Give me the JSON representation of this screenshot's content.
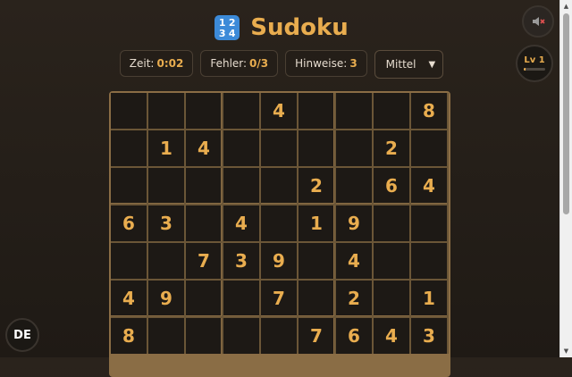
{
  "header": {
    "icon_digits": [
      "1",
      "2",
      "3",
      "4"
    ],
    "title": "Sudoku"
  },
  "stats": {
    "time_label": "Zeit:",
    "time_value": "0:02",
    "errors_label": "Fehler:",
    "errors_value": "0/3",
    "hints_label": "Hinweise:",
    "hints_value": "3"
  },
  "difficulty": {
    "selected": "Mittel"
  },
  "controls": {
    "mute_icon": "speaker-muted-icon",
    "level_label": "Lv 1",
    "level_progress": 0.1,
    "language": "DE"
  },
  "board": {
    "rows": [
      [
        "",
        "",
        "",
        "",
        "4",
        "",
        "",
        "",
        "8"
      ],
      [
        "",
        "1",
        "4",
        "",
        "",
        "",
        "",
        "2",
        ""
      ],
      [
        "",
        "",
        "",
        "",
        "",
        "2",
        "",
        "6",
        "4"
      ],
      [
        "6",
        "3",
        "",
        "4",
        "",
        "1",
        "9",
        "",
        ""
      ],
      [
        "",
        "",
        "7",
        "3",
        "9",
        "",
        "4",
        "",
        ""
      ],
      [
        "4",
        "9",
        "",
        "",
        "7",
        "",
        "2",
        "",
        "1"
      ],
      [
        "8",
        "",
        "",
        "",
        "",
        "7",
        "6",
        "4",
        "3"
      ]
    ]
  },
  "colors": {
    "accent": "#e9ad4f",
    "background": "#231d17",
    "grid": "#8a6d45",
    "title_icon": "#3c8ad8"
  }
}
